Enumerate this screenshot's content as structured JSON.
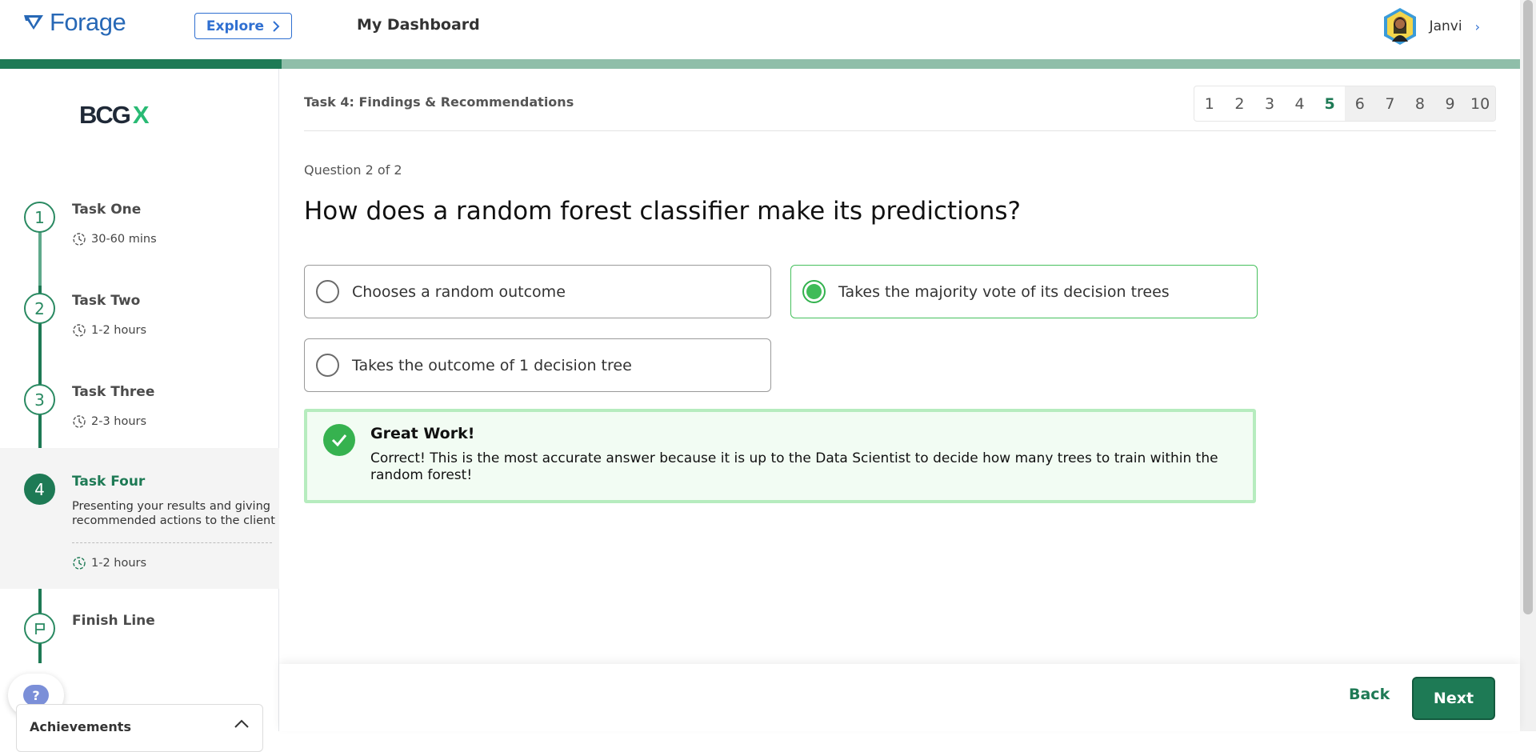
{
  "header": {
    "logo_text": "Forage",
    "explore_label": "Explore",
    "dashboard_title": "My Dashboard",
    "user_name": "Janvi"
  },
  "progress": {
    "completed_fraction": 0.185
  },
  "sidebar": {
    "company_logo": {
      "main": "BCG",
      "accent": "X",
      "accent_color": "#29ba74"
    },
    "tasks": [
      {
        "number": "1",
        "name": "Task One",
        "duration": "30-60 mins"
      },
      {
        "number": "2",
        "name": "Task Two",
        "duration": "1-2 hours"
      },
      {
        "number": "3",
        "name": "Task Three",
        "duration": "2-3 hours"
      },
      {
        "number": "4",
        "name": "Task Four",
        "description": "Presenting your results and giving recommended actions to the client",
        "duration": "1-2 hours",
        "active": true
      }
    ],
    "finish_label": "Finish Line",
    "help_label": "?",
    "achievements_label": "Achievements"
  },
  "main": {
    "task_title": "Task 4: Findings & Recommendations",
    "pages": [
      "1",
      "2",
      "3",
      "4",
      "5",
      "6",
      "7",
      "8",
      "9",
      "10"
    ],
    "current_page": "5",
    "question_count": "Question 2 of 2",
    "question": "How does a random forest classifier make its predictions?",
    "options": [
      {
        "label": "Chooses a random outcome",
        "selected": false
      },
      {
        "label": "Takes the majority vote of its decision trees",
        "selected": true
      },
      {
        "label": "Takes the outcome of 1 decision tree",
        "selected": false
      }
    ],
    "feedback": {
      "title": "Great Work!",
      "body": "Correct! This is the most accurate answer because it is up to the Data Scientist to decide how many trees to train within the random forest!"
    }
  },
  "footer": {
    "back_label": "Back",
    "next_label": "Next"
  },
  "colors": {
    "brand_green": "#1e7a55",
    "success_green": "#36b24f",
    "forage_blue": "#2768b6"
  }
}
